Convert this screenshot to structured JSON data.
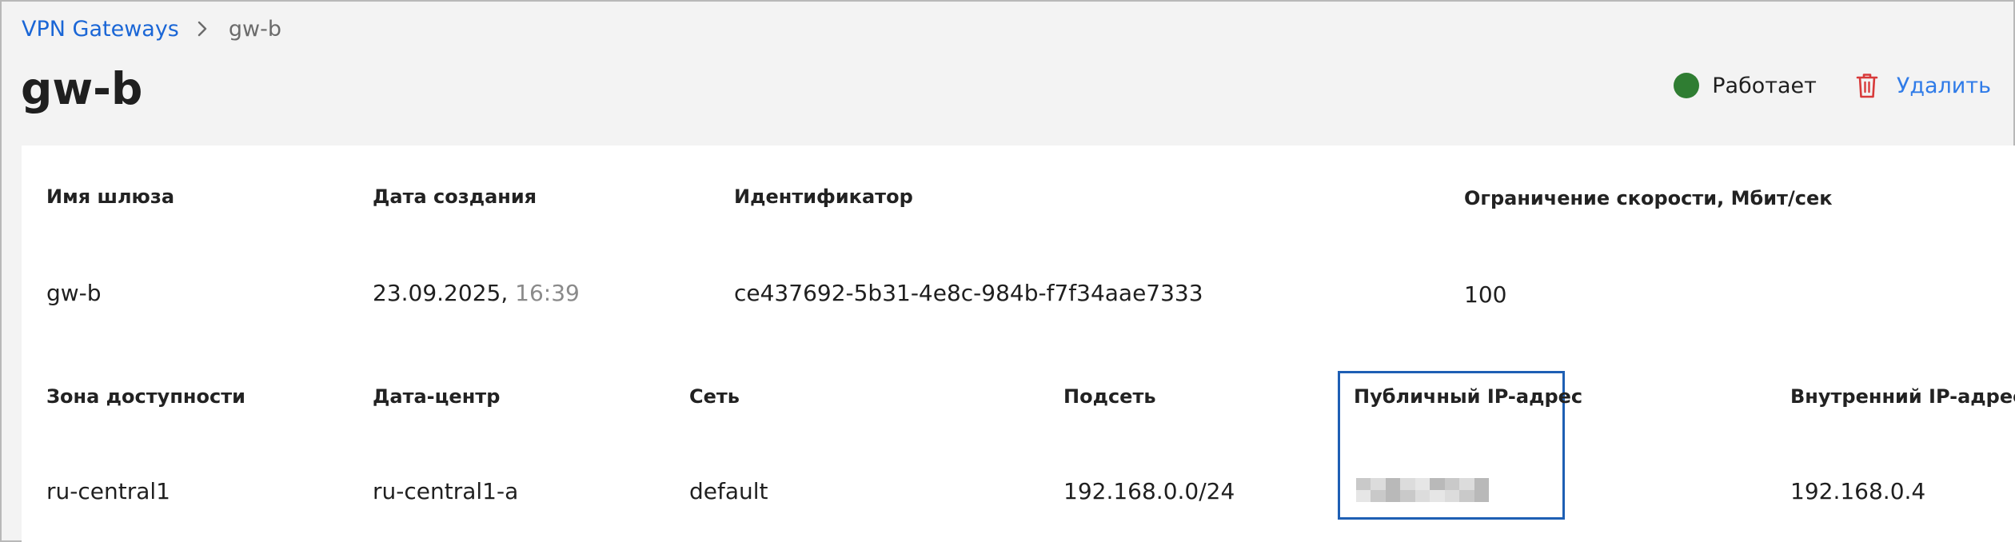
{
  "breadcrumb": {
    "parent": "VPN Gateways",
    "current": "gw-b"
  },
  "header": {
    "title": "gw-b",
    "status": {
      "label": "Работает",
      "color": "#2f7d32"
    },
    "delete_label": "Удалить"
  },
  "details": {
    "gateway_name": {
      "label": "Имя шлюза",
      "value": "gw-b"
    },
    "created": {
      "label": "Дата создания",
      "date": "23.09.2025,",
      "time": "16:39"
    },
    "identifier": {
      "label": "Идентификатор",
      "value": "ce437692-5b31-4e8c-984b-f7f34aae7333"
    },
    "speed_limit": {
      "label": "Ограничение скорости, Мбит/сек",
      "value": "100"
    },
    "availability_zone": {
      "label": "Зона доступности",
      "value": "ru-central1"
    },
    "datacenter": {
      "label": "Дата-центр",
      "value": "ru-central1-a"
    },
    "network": {
      "label": "Сеть",
      "value": "default"
    },
    "subnet": {
      "label": "Подсеть",
      "value": "192.168.0.0/24"
    },
    "public_ip": {
      "label": "Публичный IP-адрес"
    },
    "internal_ip": {
      "label": "Внутренний IP-адрес",
      "value": "192.168.0.4"
    }
  },
  "colors": {
    "link": "#1a66d6",
    "delete": "#2f7be8",
    "trash_icon": "#d83a3a",
    "highlight": "#1e5fb4"
  }
}
